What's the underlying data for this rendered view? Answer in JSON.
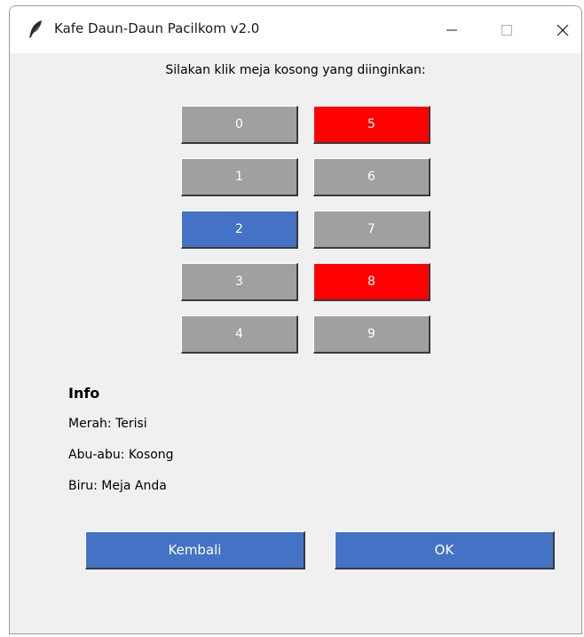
{
  "window": {
    "title": "Kafe Daun-Daun Pacilkom v2.0",
    "icon": "feather-icon",
    "controls": [
      "minimize-icon",
      "maximize-icon",
      "close-icon"
    ]
  },
  "prompt": "Silakan klik meja kosong yang diinginkan:",
  "tables": [
    {
      "label": "0",
      "status": "kosong",
      "color": "#a0a0a0"
    },
    {
      "label": "1",
      "status": "kosong",
      "color": "#a0a0a0"
    },
    {
      "label": "2",
      "status": "anda",
      "color": "#4472c4"
    },
    {
      "label": "3",
      "status": "kosong",
      "color": "#a0a0a0"
    },
    {
      "label": "4",
      "status": "kosong",
      "color": "#a0a0a0"
    },
    {
      "label": "5",
      "status": "terisi",
      "color": "#ff0000"
    },
    {
      "label": "6",
      "status": "kosong",
      "color": "#a0a0a0"
    },
    {
      "label": "7",
      "status": "kosong",
      "color": "#a0a0a0"
    },
    {
      "label": "8",
      "status": "terisi",
      "color": "#ff0000"
    },
    {
      "label": "9",
      "status": "kosong",
      "color": "#a0a0a0"
    }
  ],
  "info": {
    "title": "Info",
    "legend": [
      "Merah: Terisi",
      "Abu-abu: Kosong",
      "Biru: Meja Anda"
    ]
  },
  "buttons": {
    "back_label": "Kembali",
    "ok_label": "OK",
    "color": "#4472c4"
  }
}
